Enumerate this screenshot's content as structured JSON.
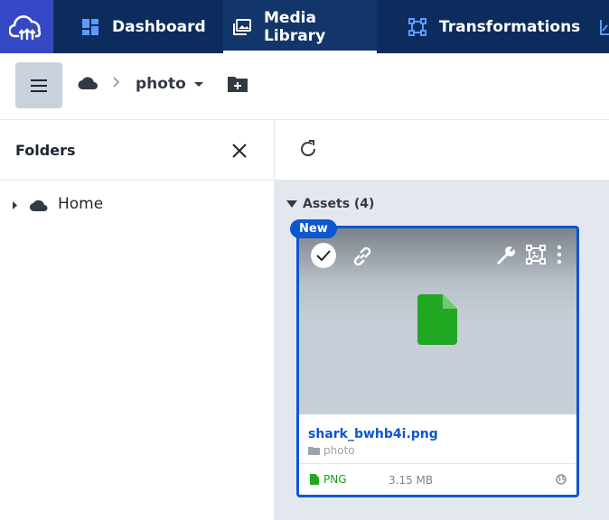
{
  "colors": {
    "nav_bg": "#0d2c5e",
    "logo_bg": "#3448c5",
    "accent": "#0b57d0",
    "file_green": "#22a722"
  },
  "nav": {
    "tabs": [
      {
        "label": "Dashboard",
        "icon": "dashboard-icon"
      },
      {
        "label": "Media Library",
        "icon": "media-library-icon",
        "active": true
      },
      {
        "label": "Transformations",
        "icon": "transformations-icon"
      },
      {
        "label": "",
        "icon": "chart-icon"
      }
    ]
  },
  "breadcrumb": {
    "current": "photo"
  },
  "folders": {
    "title": "Folders",
    "tree": [
      {
        "label": "Home",
        "icon": "cloud-icon"
      }
    ]
  },
  "assets": {
    "heading": "Assets (4)",
    "cards": [
      {
        "badge": "New",
        "filename": "shark_bwhb4i.png",
        "folder": "photo",
        "type": "PNG",
        "size": "3.15 MB"
      }
    ]
  }
}
